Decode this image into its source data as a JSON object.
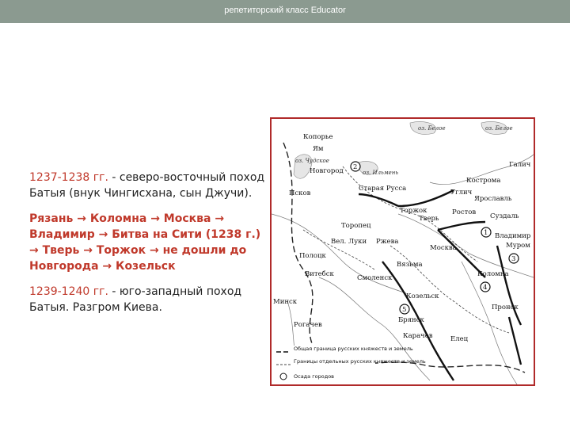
{
  "header": {
    "title": "репетиторский класс Educator",
    "bg_color": "#8b9a90"
  },
  "text": {
    "p1": "1237-1238 гг.",
    "p1_rest": " - северо-восточный поход Батыя (внук Чингисхана, сын Джучи).",
    "route": "Рязань → Коломна → Москва → Владимир → Битва на Сити (1238 г.) → Тверь → Торжок → не дошли до Новгорода → Козельск",
    "p3": "1239-1240 гг.",
    "p3_rest": " - юго-западный поход Батыя. Разгром Киева."
  },
  "colors": {
    "accent_red": "#c0392b",
    "frame_red": "#b02a2a"
  },
  "map": {
    "cities": [
      "Копорье",
      "Ям",
      "Новгород",
      "Псков",
      "Старая Русса",
      "Торжок",
      "Тверь",
      "Торопец",
      "Вел. Луки",
      "Ржева",
      "Полоцк",
      "Витебск",
      "Смоленск",
      "Вязьма",
      "Минск",
      "Рогачев",
      "Козельск",
      "Брянск",
      "Карачев",
      "Елец",
      "Пронск",
      "Коломна",
      "Москва",
      "Ростов",
      "Углич",
      "Кострома",
      "Ярославль",
      "Суздаль",
      "Владимир",
      "Галич",
      "Муром"
    ],
    "water": [
      "оз. Чудское",
      "оз. Ильмень",
      "оз. Белое",
      "оз. Белое"
    ],
    "sieges": [
      "1",
      "2",
      "3",
      "4",
      "5"
    ],
    "legend": [
      "Общая граница русских княжеств и земель",
      "Границы отдельных русских княжеств и земель",
      "Осада городов"
    ]
  }
}
